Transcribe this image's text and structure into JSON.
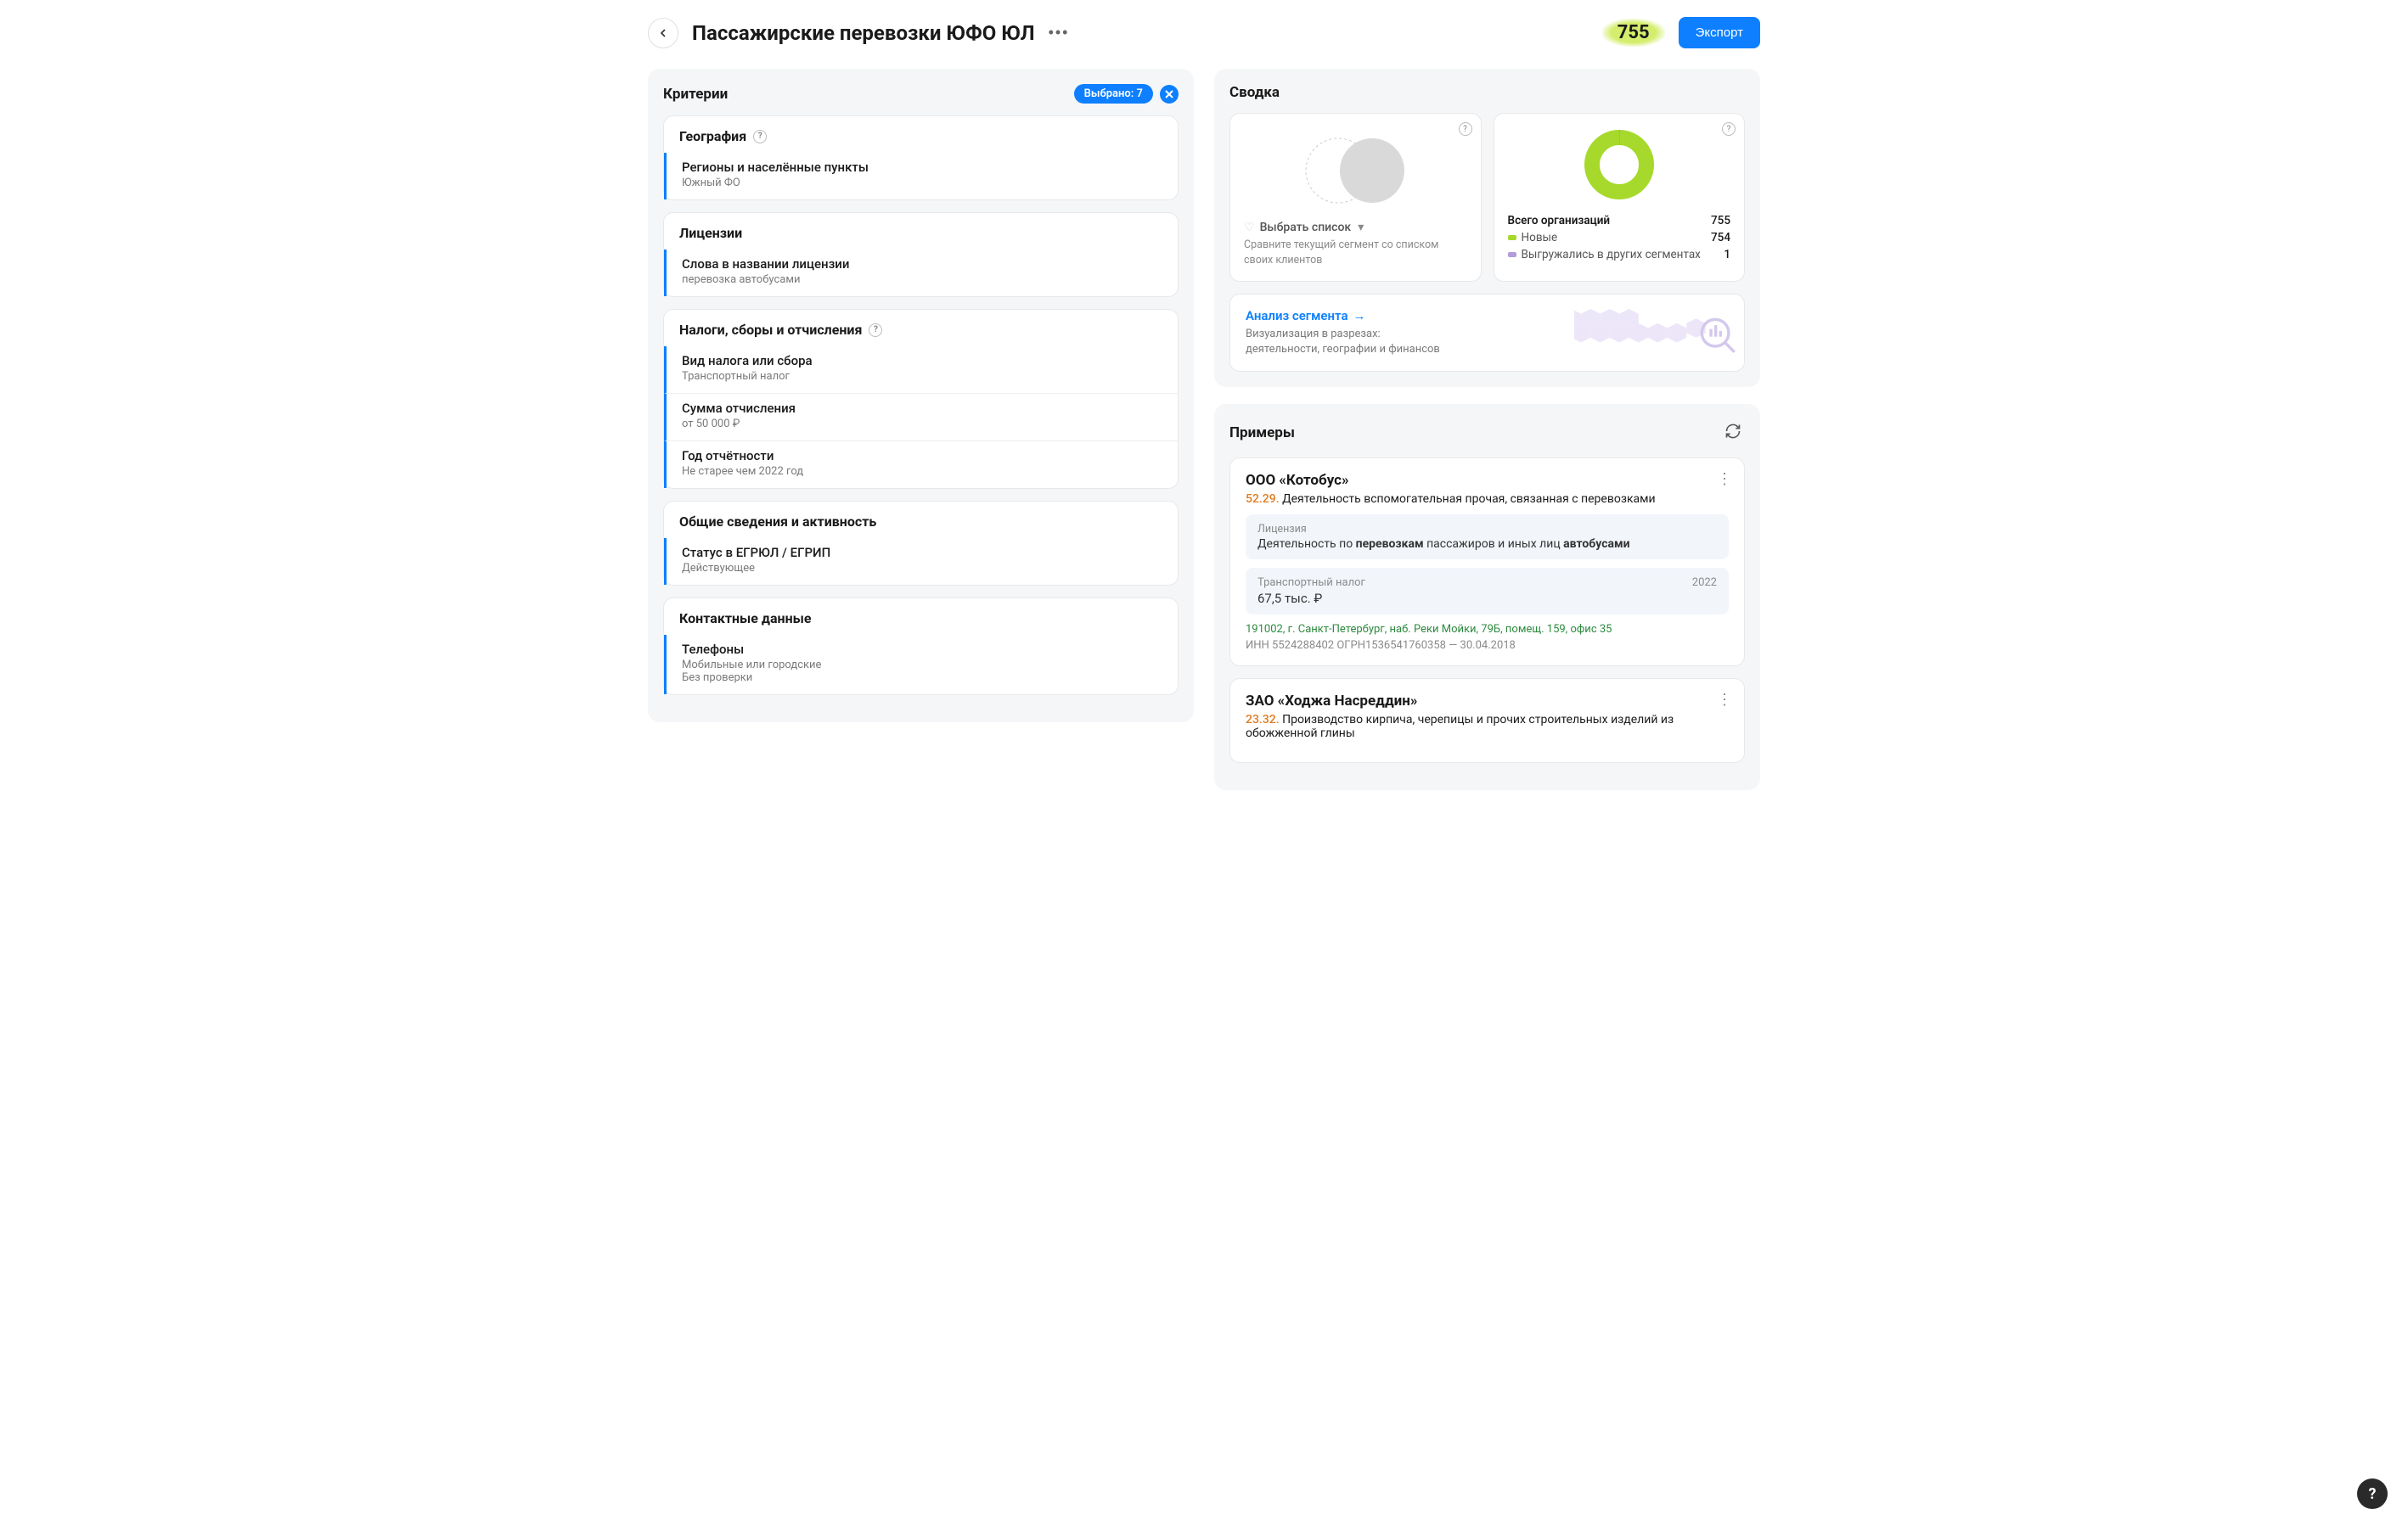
{
  "header": {
    "title": "Пассажирские перевозки ЮФО ЮЛ",
    "count": "755",
    "export_label": "Экспорт"
  },
  "criteria": {
    "panel_title": "Критерии",
    "selected_chip": "Выбрано: 7",
    "groups": [
      {
        "title": "География",
        "has_help": true,
        "items": [
          {
            "label": "Регионы и населённые пункты",
            "value": "Южный ФО"
          }
        ]
      },
      {
        "title": "Лицензии",
        "has_help": false,
        "items": [
          {
            "label": "Слова в названии лицензии",
            "value": "перевозка автобусами"
          }
        ]
      },
      {
        "title": "Налоги, сборы и отчисления",
        "has_help": true,
        "items": [
          {
            "label": "Вид налога или сбора",
            "value": "Транспортный налог"
          },
          {
            "label": "Сумма отчисления",
            "value": "от 50 000 ₽"
          },
          {
            "label": "Год отчётности",
            "value": "Не старее чем 2022 год"
          }
        ]
      },
      {
        "title": "Общие сведения и активность",
        "has_help": false,
        "items": [
          {
            "label": "Статус в ЕГРЮЛ / ЕГРИП",
            "value": "Действующее"
          }
        ]
      },
      {
        "title": "Контактные данные",
        "has_help": false,
        "items": [
          {
            "label": "Телефоны",
            "value": "Мобильные или городские\nБез проверки"
          }
        ]
      }
    ]
  },
  "summary": {
    "panel_title": "Сводка",
    "compare": {
      "select_label": "Выбрать список",
      "description": "Сравните текущий сегмент со списком своих клиентов"
    },
    "donut": {
      "total_label": "Всего организаций",
      "total_value": "755",
      "rows": [
        {
          "color": "green",
          "label": "Новые",
          "value": "754"
        },
        {
          "color": "purple",
          "label": "Выгружались в других сегментах",
          "value": "1"
        }
      ]
    },
    "analysis": {
      "link": "Анализ сегмента",
      "desc": "Визуализация в разрезах:\nдеятельности, географии и финансов"
    }
  },
  "examples": {
    "panel_title": "Примеры",
    "items": [
      {
        "name": "ООО «Котобус»",
        "activity_code": "52.29.",
        "activity_text": "Деятельность вспомогательная прочая, связанная с перевозками",
        "license_label": "Лицензия",
        "license_text_pre": "Деятельность по ",
        "license_text_b1": "перевозкам",
        "license_text_mid": " пассажиров и иных лиц ",
        "license_text_b2": "автобусами",
        "tax_label": "Транспортный налог",
        "tax_year": "2022",
        "tax_amount": "67,5 тыс. ₽",
        "address": "191002, г. Санкт-Петербург, наб. Реки Мойки, 79Б, помещ. 159, офис 35",
        "meta": "ИНН 5524288402    ОГРН1536541760358 — 30.04.2018"
      },
      {
        "name": "ЗАО «Ходжа Насреддин»",
        "activity_code": "23.32.",
        "activity_text": "Производство кирпича, черепицы и прочих строительных изделий из обожженной глины"
      }
    ]
  },
  "chart_data": {
    "type": "pie",
    "title": "Всего организаций",
    "series": [
      {
        "name": "Новые",
        "value": 754,
        "color": "#a6d92b"
      },
      {
        "name": "Выгружались в других сегментах",
        "value": 1,
        "color": "#b39ddb"
      }
    ],
    "total": 755
  }
}
